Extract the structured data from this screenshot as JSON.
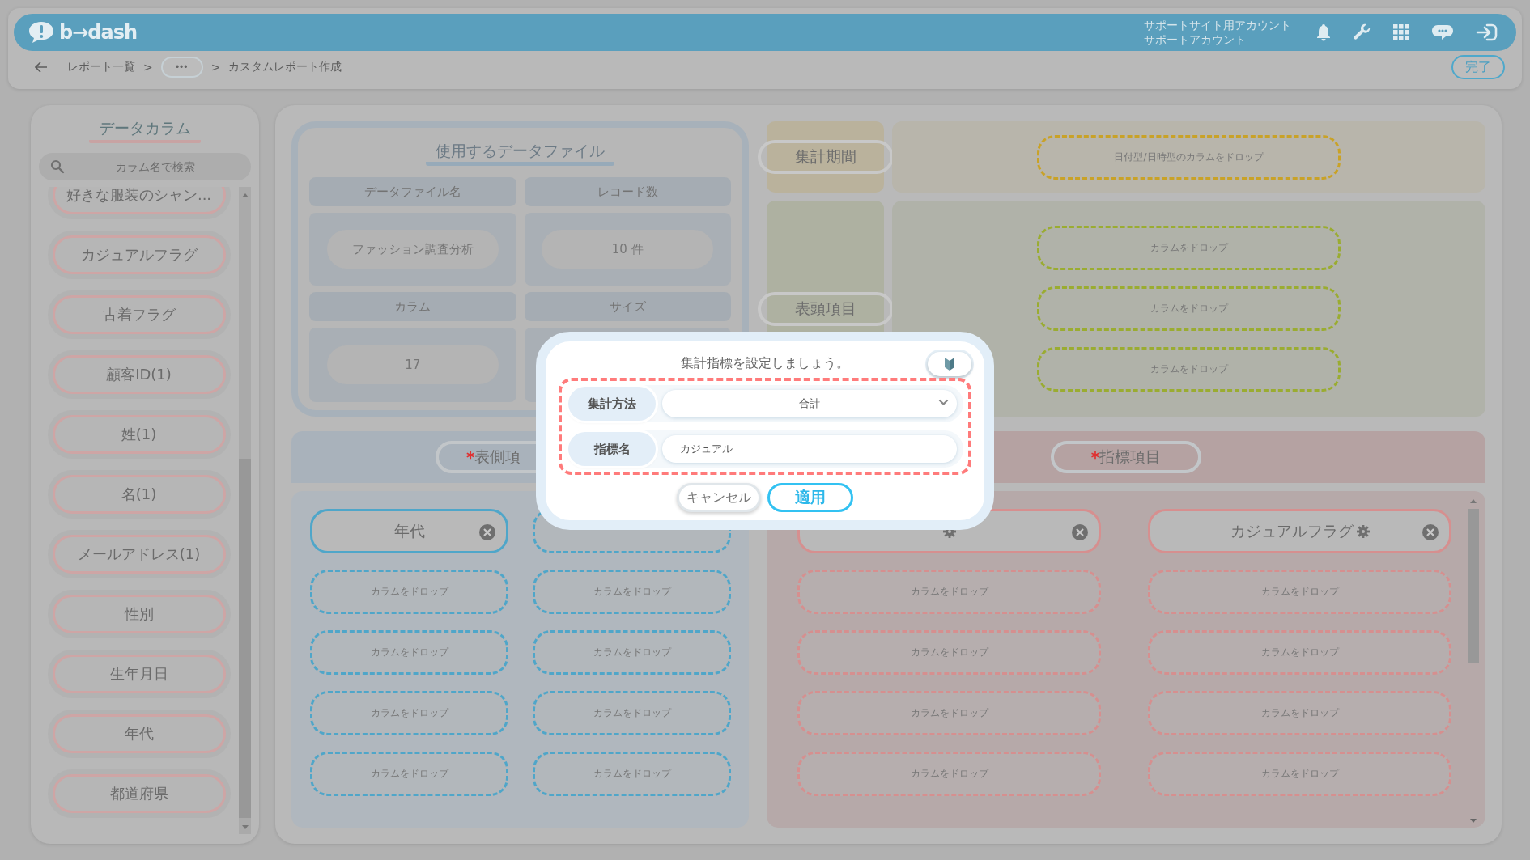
{
  "header": {
    "logo": "b→dash",
    "account_lines": [
      "サポートサイト用アカウント",
      "サポートアカウント"
    ]
  },
  "breadcrumb": [
    {
      "kind": "link",
      "label": "レポート一覧"
    },
    {
      "kind": "separator",
      "label": ">"
    },
    {
      "kind": "more",
      "label": "•••"
    },
    {
      "kind": "separator",
      "label": ">"
    },
    {
      "kind": "current",
      "label": "カスタムレポート作成"
    }
  ],
  "done_button": "完了",
  "sidebar": {
    "title": "データカラム",
    "search_placeholder": "カラム名で検索",
    "items": [
      "好きな服装のシャン...",
      "カジュアルフラグ",
      "古着フラグ",
      "顧客ID(1)",
      "姓(1)",
      "名(1)",
      "メールアドレス(1)",
      "性別",
      "生年月日",
      "年代",
      "都道府県"
    ]
  },
  "data_file": {
    "title": "使用するデータファイル",
    "cells": [
      {
        "heading": "データファイル名",
        "value": "ファッション調査分析"
      },
      {
        "heading": "レコード数",
        "value": "10 件"
      },
      {
        "heading": "カラム",
        "value": "17"
      },
      {
        "heading": "サイズ"
      }
    ]
  },
  "period": {
    "label": "集計期間",
    "slots": [
      "日付型/日時型のカラムをドロップ"
    ]
  },
  "column_header": {
    "label": "表頭項目",
    "slots": [
      "カラムをドロップ",
      "カラムをドロップ",
      "カラムをドロップ"
    ]
  },
  "row_items": {
    "label": "$^{*}$表側項",
    "columns": [
      [
        {
          "kind": "filled",
          "label": "年代",
          "settings": false
        },
        {
          "kind": "empty",
          "label": "カラムをドロップ"
        },
        {
          "kind": "empty",
          "label": "カラムをドロップ"
        },
        {
          "kind": "empty",
          "label": "カラムをドロップ"
        },
        {
          "kind": "empty",
          "label": "カラムをドロップ"
        }
      ],
      [
        {
          "kind": "empty"
        },
        {
          "kind": "empty",
          "label": "カラムをドロップ"
        },
        {
          "kind": "empty",
          "label": "カラムをドロップ"
        },
        {
          "kind": "empty",
          "label": "カラムをドロップ"
        },
        {
          "kind": "empty",
          "label": "カラムをドロップ"
        }
      ]
    ]
  },
  "metric_items": {
    "label": "$^{*}$指標項目",
    "columns": [
      [
        {
          "kind": "filled",
          "settings": true
        },
        {
          "kind": "empty",
          "label": "カラムをドロップ"
        },
        {
          "kind": "empty",
          "label": "カラムをドロップ"
        },
        {
          "kind": "empty",
          "label": "カラムをドロップ"
        },
        {
          "kind": "empty",
          "label": "カラムをドロップ"
        }
      ],
      [
        {
          "kind": "filled",
          "label": "カジュアルフラグ",
          "settings": true
        },
        {
          "kind": "empty",
          "label": "カラムをドロップ"
        },
        {
          "kind": "empty",
          "label": "カラムをドロップ"
        },
        {
          "kind": "empty",
          "label": "カラムをドロップ"
        },
        {
          "kind": "empty",
          "label": "カラムをドロップ"
        }
      ]
    ]
  },
  "dialog": {
    "title": "集計指標を設定しましょう。",
    "fields": [
      {
        "kind": "select",
        "label": "集計方法",
        "value": "合計"
      },
      {
        "kind": "text",
        "label": "指標名",
        "value": "カジュアル"
      }
    ],
    "buttons": [
      {
        "kind": "secondary",
        "label": "キャンセル"
      },
      {
        "kind": "primary",
        "label": "適用"
      }
    ]
  }
}
